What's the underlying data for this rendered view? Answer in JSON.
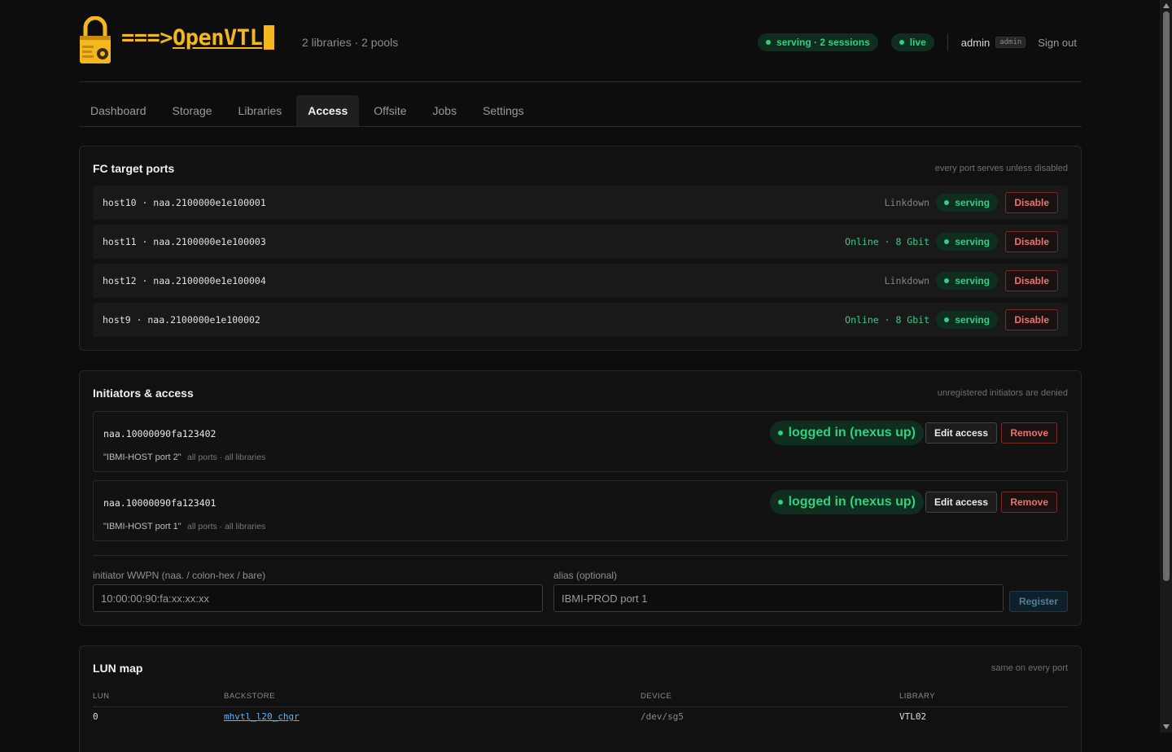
{
  "app": {
    "logo_prefix": "===>",
    "logo_name": "OpenVTL",
    "meta": "2 libraries · 2 pools",
    "status_serving": "serving · 2 sessions",
    "status_live": "live",
    "user": "admin",
    "role": "admin",
    "signout": "Sign out"
  },
  "colors": {
    "accent": "#f2b81e",
    "ok": "#2fd17f",
    "danger": "#f07070",
    "link": "#5ab4ff"
  },
  "nav": {
    "tabs": [
      {
        "label": "Dashboard"
      },
      {
        "label": "Storage"
      },
      {
        "label": "Libraries"
      },
      {
        "label": "Access",
        "active": true
      },
      {
        "label": "Offsite"
      },
      {
        "label": "Jobs"
      },
      {
        "label": "Settings"
      }
    ]
  },
  "fc_ports": {
    "title": "FC target ports",
    "note": "every port serves unless disabled",
    "rows": [
      {
        "id": "host10 · naa.2100000e1e100001",
        "link": "Linkdown",
        "state": "serving",
        "action": "Disable"
      },
      {
        "id": "host11 · naa.2100000e1e100003",
        "link": "Online · 8 Gbit",
        "state": "serving",
        "action": "Disable"
      },
      {
        "id": "host12 · naa.2100000e1e100004",
        "link": "Linkdown",
        "state": "serving",
        "action": "Disable"
      },
      {
        "id": "host9 · naa.2100000e1e100002",
        "link": "Online · 8 Gbit",
        "state": "serving",
        "action": "Disable"
      }
    ]
  },
  "initiators": {
    "title": "Initiators & access",
    "note": "unregistered initiators are denied",
    "rows": [
      {
        "id": "naa.10000090fa123402",
        "alias": "\"IBMI-HOST port 2\"",
        "scope": "all ports · all libraries",
        "status": "logged in (nexus up)",
        "edit": "Edit access",
        "remove": "Remove"
      },
      {
        "id": "naa.10000090fa123401",
        "alias": "\"IBMI-HOST port 1\"",
        "scope": "all ports · all libraries",
        "status": "logged in (nexus up)",
        "edit": "Edit access",
        "remove": "Remove"
      }
    ],
    "form": {
      "wwpn_label": "initiator WWPN (naa. / colon-hex / bare)",
      "wwpn_placeholder": "10:00:00:90:fa:xx:xx:xx",
      "alias_label": "alias (optional)",
      "alias_placeholder": "IBMI-PROD port 1",
      "register": "Register"
    }
  },
  "lun_map": {
    "title": "LUN map",
    "note": "same on every port",
    "headers": {
      "lun": "LUN",
      "backstore": "BACKSTORE",
      "device": "DEVICE",
      "library": "LIBRARY"
    },
    "rows": [
      {
        "lun": "0",
        "backstore": "mhvtl_l20_chgr",
        "device": "/dev/sg5",
        "library": "VTL02"
      }
    ]
  }
}
